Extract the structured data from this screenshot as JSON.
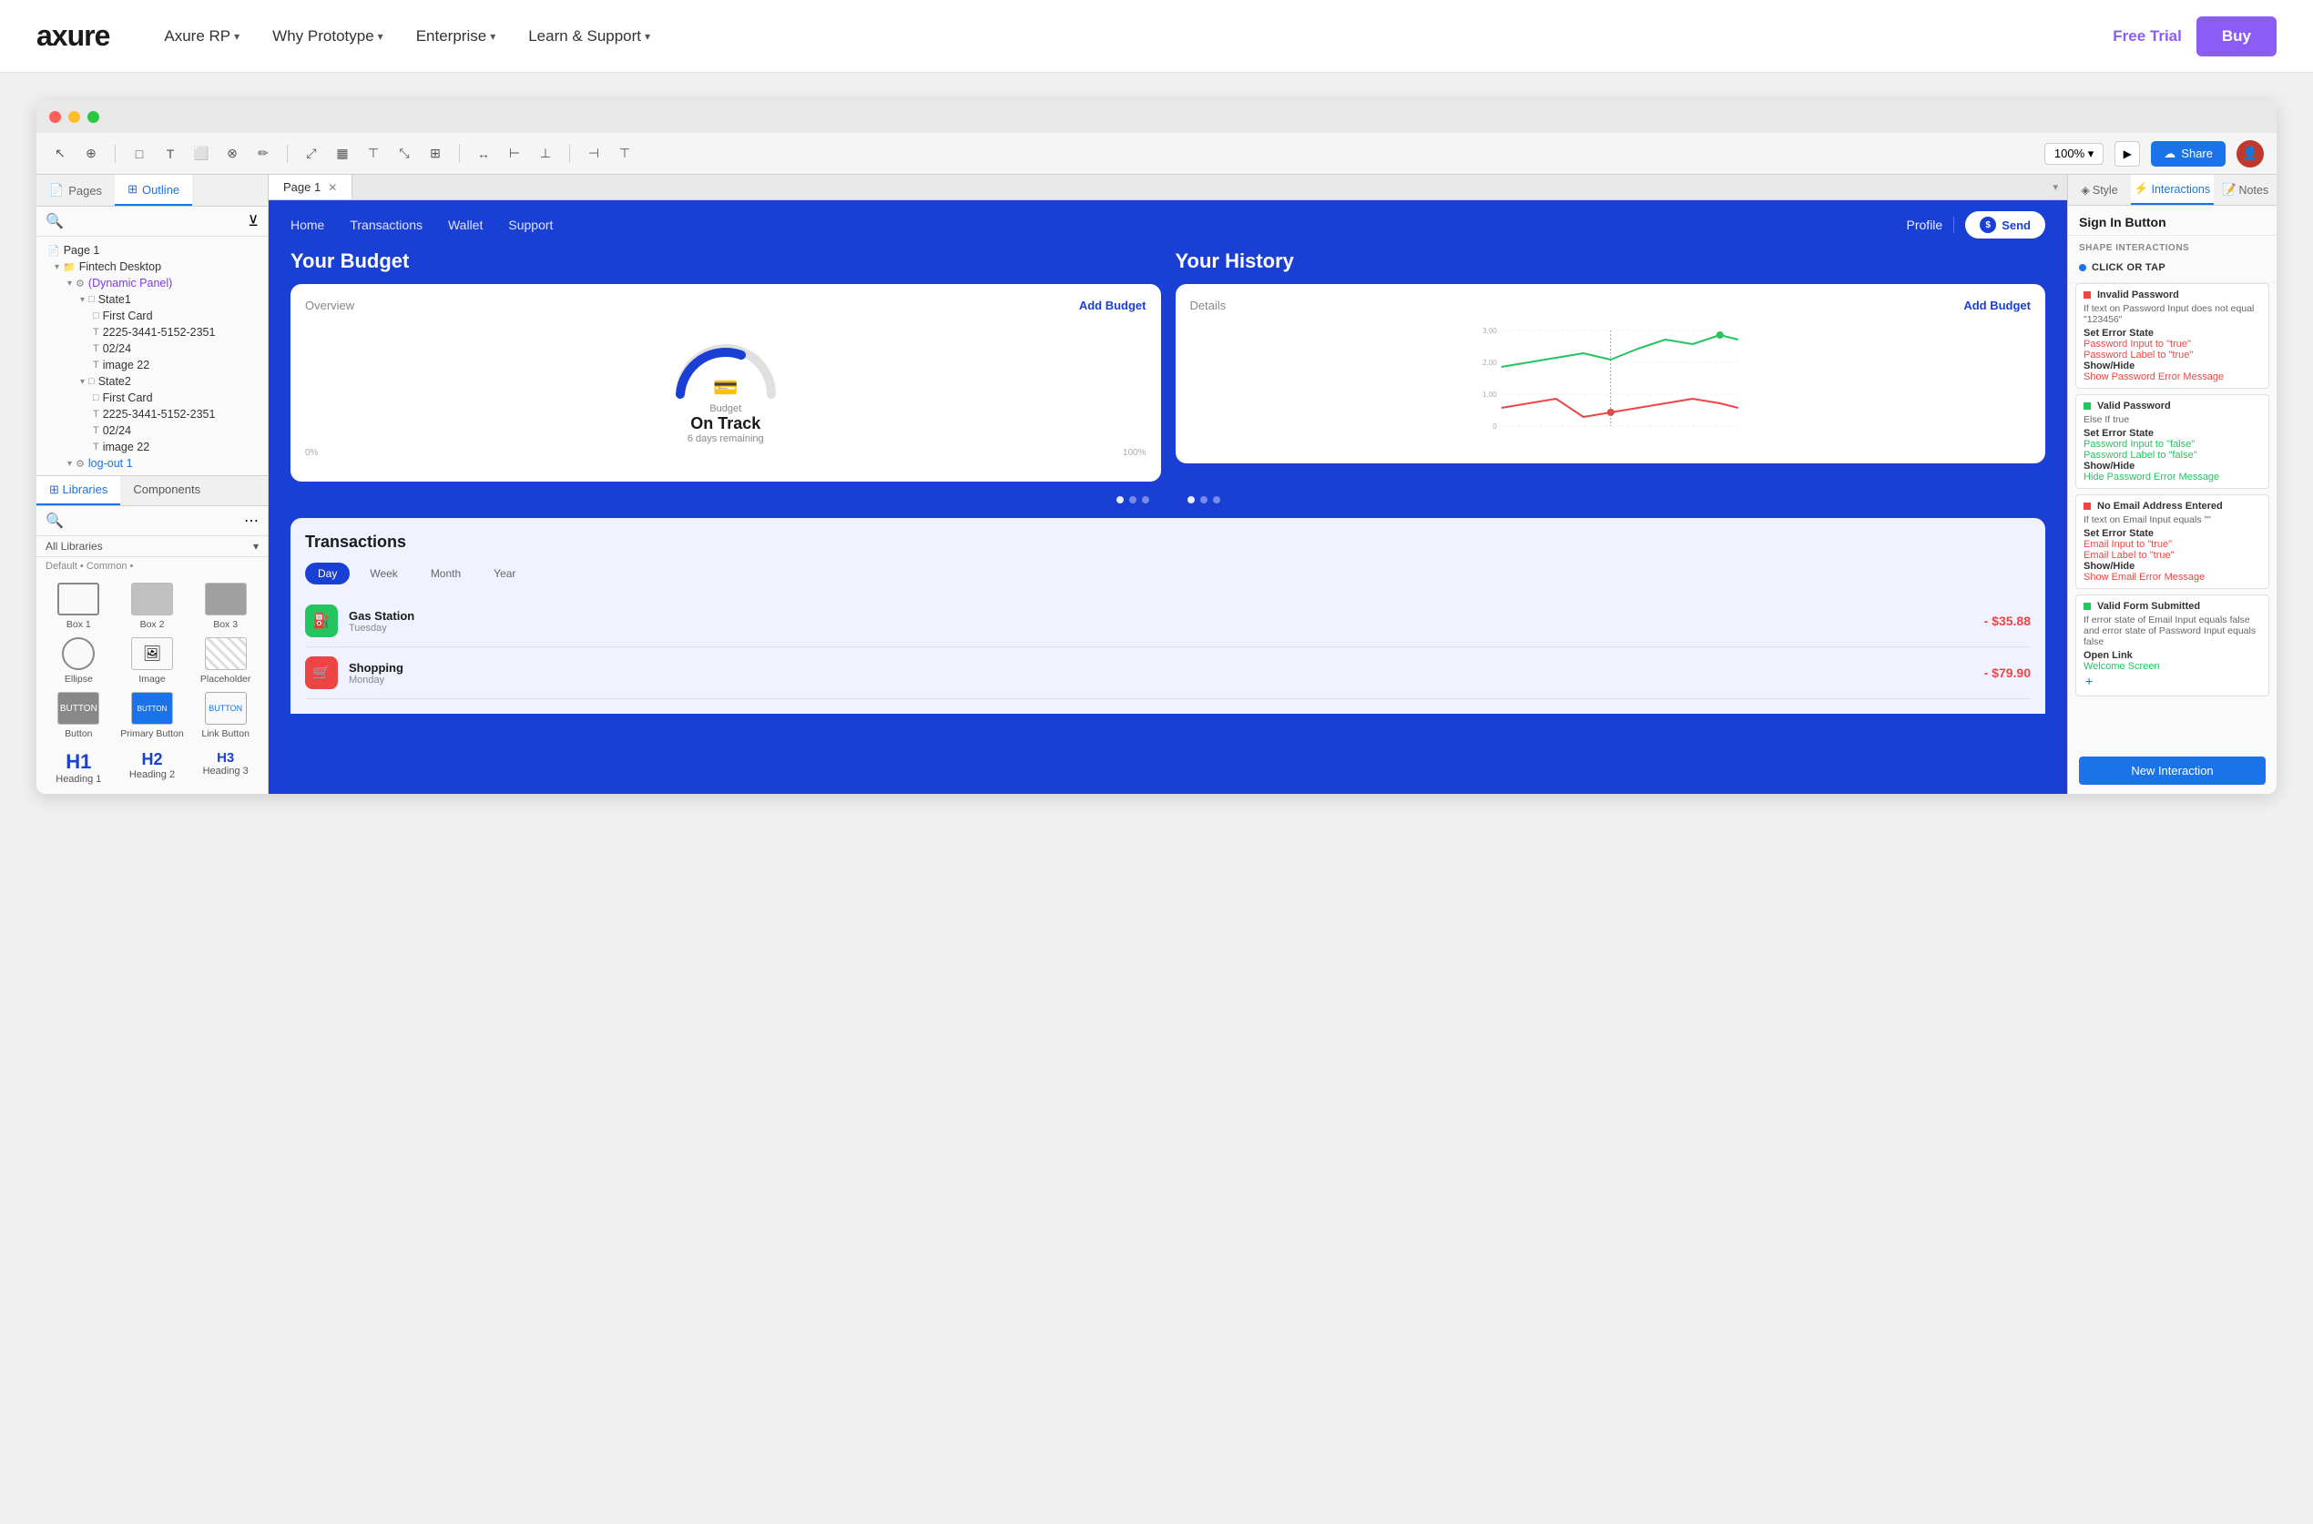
{
  "topNav": {
    "logo": "axure",
    "links": [
      {
        "label": "Axure RP",
        "arrow": "▾"
      },
      {
        "label": "Why Prototype",
        "arrow": "▾"
      },
      {
        "label": "Enterprise",
        "arrow": "▾"
      },
      {
        "label": "Learn & Support",
        "arrow": "▾"
      }
    ],
    "freeTrial": "Free Trial",
    "buy": "Buy"
  },
  "appWindow": {
    "toolbar": {
      "zoom": "100%",
      "share": "Share"
    },
    "pageTab": "Page 1"
  },
  "leftPanel": {
    "tabs": [
      "Pages",
      "Outline"
    ],
    "activeTab": "Outline",
    "tree": {
      "items": [
        {
          "label": "Page 1",
          "indent": 0,
          "icon": "📄"
        },
        {
          "label": "Fintech Desktop",
          "indent": 1,
          "icon": "📁"
        },
        {
          "label": "(Dynamic Panel)",
          "indent": 2,
          "icon": "⚙️",
          "color": "purple"
        },
        {
          "label": "State1",
          "indent": 3,
          "icon": "□"
        },
        {
          "label": "First Card",
          "indent": 4,
          "icon": "□"
        },
        {
          "label": "2225-3441-5152-2351",
          "indent": 4,
          "icon": "T"
        },
        {
          "label": "02/24",
          "indent": 4,
          "icon": "T"
        },
        {
          "label": "image 22",
          "indent": 4,
          "icon": "T"
        },
        {
          "label": "State2",
          "indent": 3,
          "icon": "□"
        },
        {
          "label": "First Card",
          "indent": 4,
          "icon": "□"
        },
        {
          "label": "2225-3441-5152-2351",
          "indent": 4,
          "icon": "T"
        },
        {
          "label": "02/24",
          "indent": 4,
          "icon": "T"
        },
        {
          "label": "image 22",
          "indent": 4,
          "icon": "T"
        },
        {
          "label": "log-out 1",
          "indent": 2,
          "icon": "⚙️",
          "color": "blue"
        }
      ]
    },
    "libraries": {
      "tabs": [
        "Libraries",
        "Components"
      ],
      "searchPlaceholder": "",
      "dropdown": "All Libraries",
      "groupLabel": "Default • Common •",
      "components": [
        {
          "label": "Box 1"
        },
        {
          "label": "Box 2"
        },
        {
          "label": "Box 3"
        },
        {
          "label": "Ellipse"
        },
        {
          "label": "Image"
        },
        {
          "label": "Placeholder"
        },
        {
          "label": "Button"
        },
        {
          "label": "Primary Button"
        },
        {
          "label": "Link Button"
        }
      ],
      "headings": [
        {
          "label": "H1",
          "text": "Heading 1"
        },
        {
          "label": "H2",
          "text": "Heading 2"
        },
        {
          "label": "H3",
          "text": "Heading 3"
        }
      ]
    }
  },
  "prototype": {
    "nav": {
      "items": [
        "Home",
        "Transactions",
        "Wallet",
        "Support"
      ],
      "profile": "Profile",
      "sendBtn": "Send"
    },
    "budgetSection": {
      "title": "Your Budget",
      "card": {
        "overviewLabel": "Overview",
        "addBudget": "Add Budget",
        "budgetLabel": "Budget",
        "status": "On Track",
        "remaining": "6 days remaining",
        "gaugeStart": "0%",
        "gaugeEnd": "100%"
      }
    },
    "historySection": {
      "title": "Your History",
      "card": {
        "detailsLabel": "Details",
        "addBudget": "Add Budget",
        "values": [
          "3,00",
          "2,00",
          "1,00",
          "0"
        ]
      }
    },
    "transactions": {
      "title": "Transactions",
      "tabs": [
        "Day",
        "Week",
        "Month",
        "Year"
      ],
      "activeTab": "Day",
      "items": [
        {
          "name": "Gas Station",
          "day": "Tuesday",
          "amount": "- $35.88",
          "icon": "⛽",
          "color": "green"
        },
        {
          "name": "Shopping",
          "day": "Monday",
          "amount": "- $79.90",
          "icon": "🛒",
          "color": "red"
        }
      ]
    }
  },
  "rightPanel": {
    "tabs": [
      "Style",
      "Interactions",
      "Notes"
    ],
    "activeTab": "Interactions",
    "title": "Sign In Button",
    "sectionLabel": "SHAPE INTERACTIONS",
    "triggerLabel": "CLICK OR TAP",
    "interactions": [
      {
        "title": "Invalid Password",
        "condition": "If text on Password Input does not equal \"123456\"",
        "actions": [
          {
            "type": "Set Error State",
            "items": [
              {
                "label": "Password Input to \"true\""
              },
              {
                "label": "Password Label to \"true\""
              }
            ]
          },
          {
            "type": "Show/Hide",
            "items": [
              {
                "label": "Show Password Error Message",
                "color": "red"
              }
            ]
          }
        ]
      },
      {
        "title": "Valid Password",
        "condition": "Else If true",
        "actions": [
          {
            "type": "Set Error State",
            "items": [
              {
                "label": "Password Input to \"false\""
              },
              {
                "label": "Password Label to \"false\""
              }
            ]
          },
          {
            "type": "Show/Hide",
            "items": [
              {
                "label": "Hide Password Error Message",
                "color": "green"
              }
            ]
          }
        ]
      },
      {
        "title": "No Email Address Entered",
        "condition": "If text on Email Input equals \"\"",
        "actions": [
          {
            "type": "Set Error State",
            "items": [
              {
                "label": "Email Input to \"true\""
              },
              {
                "label": "Email Label to \"true\""
              }
            ]
          },
          {
            "type": "Show/Hide",
            "items": [
              {
                "label": "Show Email Error Message",
                "color": "red"
              }
            ]
          }
        ]
      },
      {
        "title": "Valid Form Submitted",
        "condition": "If error state of Email Input equals false and error state of Password Input equals false",
        "actions": [
          {
            "type": "Open Link",
            "items": [
              {
                "label": "Welcome Screen",
                "color": "green"
              }
            ]
          }
        ]
      }
    ],
    "newInteractionLabel": "New Interaction"
  }
}
